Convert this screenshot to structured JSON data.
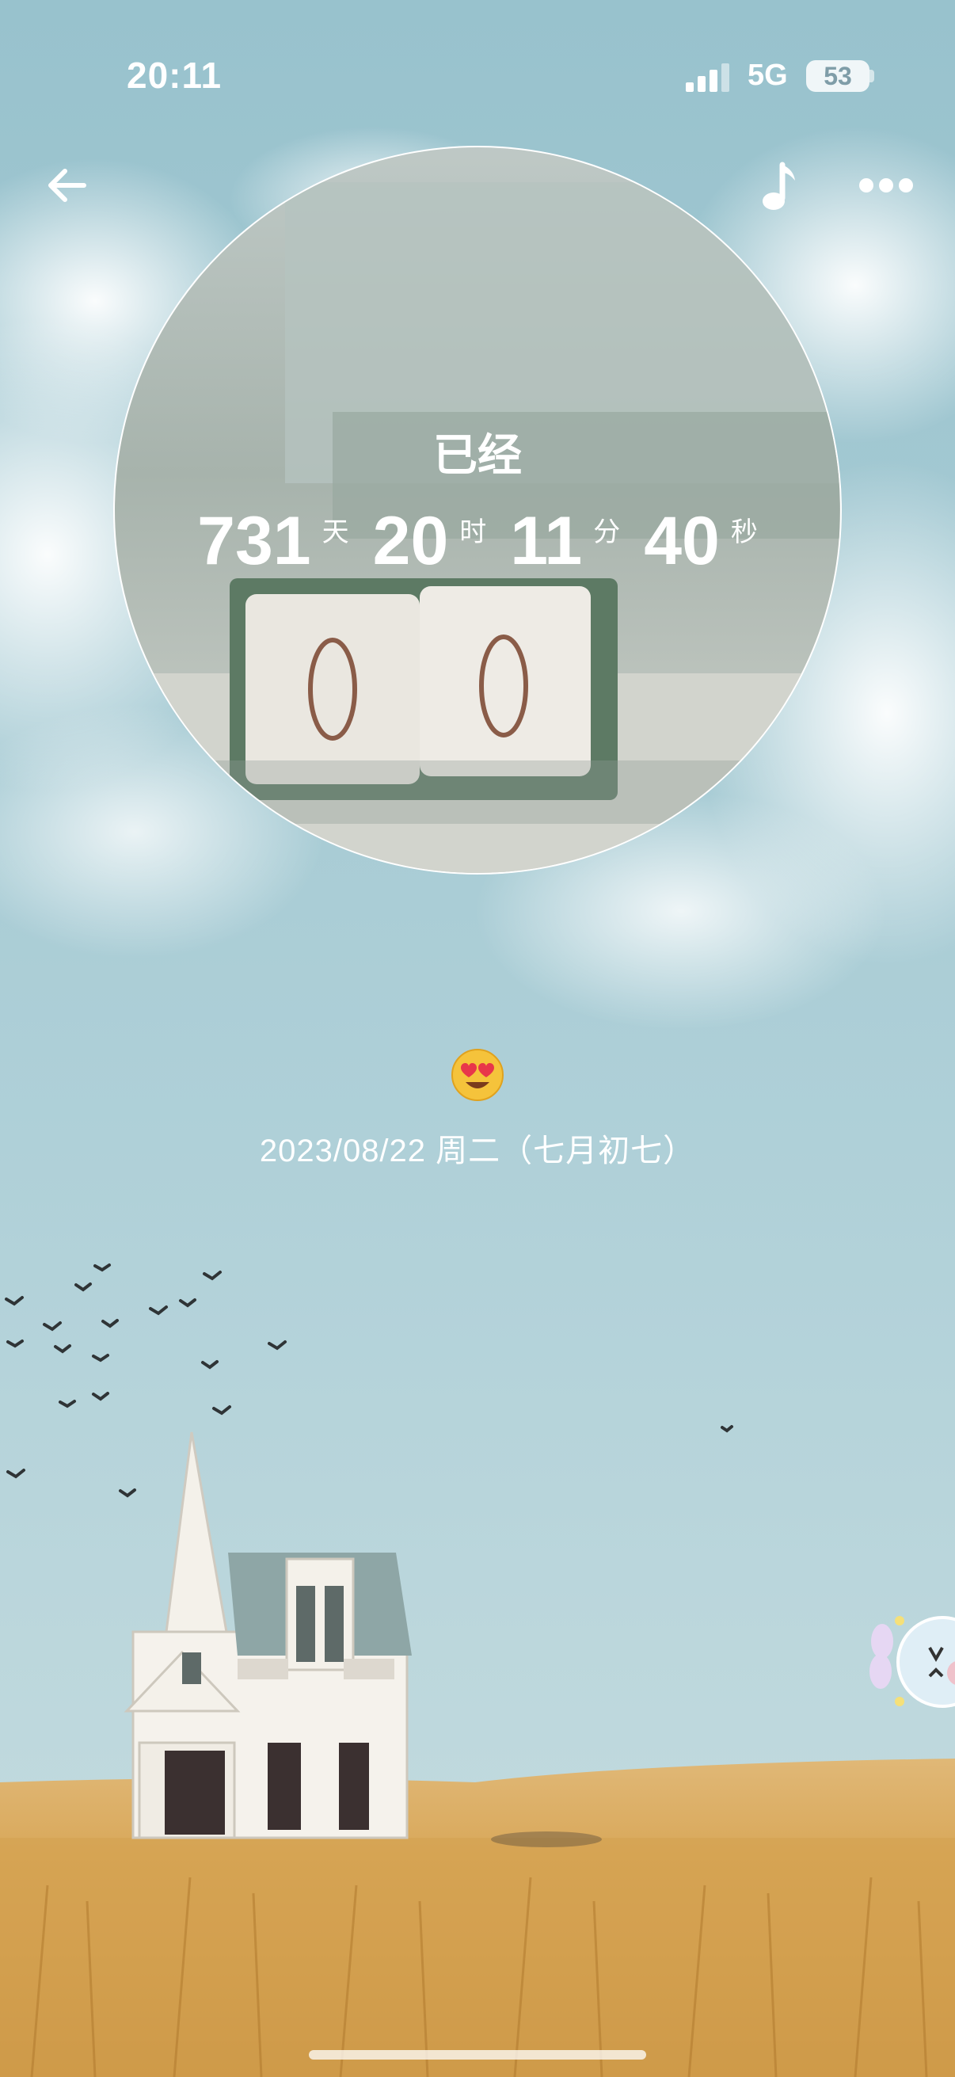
{
  "status_bar": {
    "time": "20:11",
    "network": "5G",
    "battery": "53"
  },
  "toolbar": {
    "back_icon": "arrow-left-icon",
    "music_icon": "music-note-icon",
    "more_icon": "more-dots-icon"
  },
  "counter": {
    "label": "已经",
    "days": "731",
    "days_unit": "天",
    "hours": "20",
    "hours_unit": "时",
    "minutes": "11",
    "minutes_unit": "分",
    "seconds": "40",
    "seconds_unit": "秒"
  },
  "calendar_blocks": [
    "0",
    "0"
  ],
  "mood_icon": "heart-eyes-emoji-icon",
  "date_line": "2023/08/22 周二（七月初七）",
  "floating_widget_icon": "bunny-face-icon",
  "colors": {
    "sky_top": "#9cc4cf",
    "sky_bottom": "#b9d5dc",
    "wheat": "#d9ad5f",
    "text": "#ffffff"
  }
}
